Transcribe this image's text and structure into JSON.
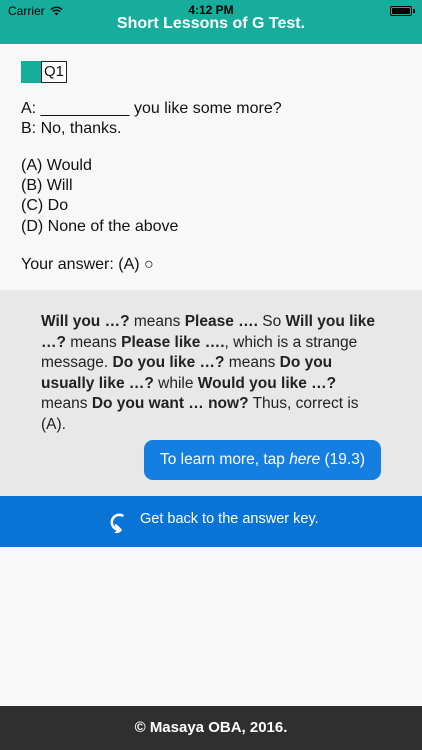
{
  "status_bar": {
    "carrier": "Carrier",
    "time": "4:12 PM",
    "wifi_icon": "wifi-icon",
    "battery_icon": "battery-icon"
  },
  "header": {
    "title": "Short Lessons of G Test.",
    "color": "#17ad9c"
  },
  "question": {
    "number_label": "Q1",
    "dialogue": [
      "A: __________ you like some more?",
      "B: No, thanks."
    ],
    "options": [
      "(A) Would",
      "(B) Will",
      "(C) Do",
      "(D) None of the above"
    ],
    "your_answer": "Your answer: (A) ○"
  },
  "explanation": {
    "segments": [
      {
        "text": "Will you …?",
        "bold": true
      },
      {
        "text": " means ",
        "bold": false
      },
      {
        "text": "Please ….",
        "bold": true
      },
      {
        "text": " So ",
        "bold": false
      },
      {
        "text": "Will you like …?",
        "bold": true
      },
      {
        "text": " means ",
        "bold": false
      },
      {
        "text": "Please like ….",
        "bold": true
      },
      {
        "text": ", which is a strange message. ",
        "bold": false
      },
      {
        "text": "Do you like …?",
        "bold": true
      },
      {
        "text": " means ",
        "bold": false
      },
      {
        "text": "Do you usually like …?",
        "bold": true
      },
      {
        "text": " while ",
        "bold": false
      },
      {
        "text": "Would you like …?",
        "bold": true
      },
      {
        "text": " means ",
        "bold": false
      },
      {
        "text": "Do you want … now?",
        "bold": true
      },
      {
        "text": " Thus, correct is (A).",
        "bold": false
      }
    ],
    "learn_more": {
      "prefix": "To learn more, tap ",
      "link": "here",
      "suffix": " (19.3)",
      "color": "#147fe0"
    }
  },
  "back_button": {
    "label": "Get back to the answer key.",
    "icon": "return-arrow-icon",
    "color": "#0a73d6"
  },
  "footer": {
    "text": "© Masaya OBA, 2016."
  }
}
